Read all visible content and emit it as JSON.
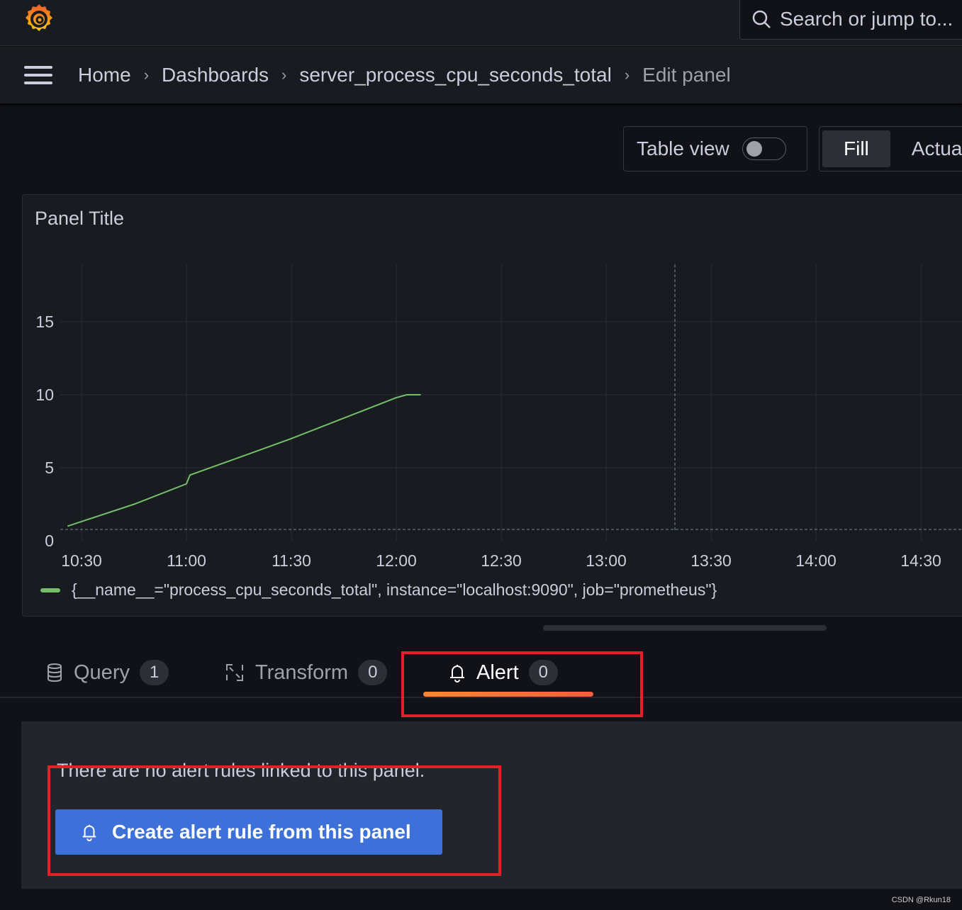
{
  "topbar": {
    "search_placeholder": "Search or jump to..."
  },
  "breadcrumb": [
    "Home",
    "Dashboards",
    "server_process_cpu_seconds_total",
    "Edit panel"
  ],
  "toolbar": {
    "table_view_label": "Table view",
    "table_view_on": false,
    "fill_label": "Fill",
    "actual_label": "Actual"
  },
  "panel": {
    "title": "Panel Title"
  },
  "chart_data": {
    "type": "line",
    "x_ticks": [
      "10:30",
      "11:00",
      "11:30",
      "12:00",
      "12:30",
      "13:00",
      "13:30",
      "14:00",
      "14:30"
    ],
    "y_ticks": [
      "0",
      "5",
      "10",
      "15"
    ],
    "ylim": [
      0,
      19
    ],
    "grid": true,
    "legend_placement": "bottom-left",
    "series": [
      {
        "name": "{__name__=\"process_cpu_seconds_total\", instance=\"localhost:9090\", job=\"prometheus\"}",
        "color": "#73bf69",
        "x": [
          "10:26",
          "10:45",
          "11:00",
          "11:01",
          "11:15",
          "11:30",
          "11:45",
          "12:00",
          "12:03",
          "12:07"
        ],
        "y": [
          1.0,
          2.5,
          3.9,
          4.5,
          5.7,
          7.0,
          8.4,
          9.8,
          10.0,
          10.0
        ]
      }
    ]
  },
  "tabs": [
    {
      "label": "Query",
      "count": "1"
    },
    {
      "label": "Transform",
      "count": "0"
    },
    {
      "label": "Alert",
      "count": "0",
      "active": true
    }
  ],
  "alert": {
    "message": "There are no alert rules linked to this panel.",
    "create_button": "Create alert rule from this panel"
  },
  "watermark": "CSDN @Rkun18",
  "colors": {
    "accent": "#3d71d9",
    "series": "#73bf69",
    "tab_underline": "#ff8833",
    "annotation": "#e0202a"
  }
}
